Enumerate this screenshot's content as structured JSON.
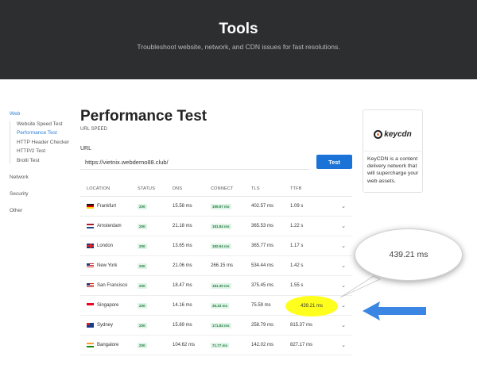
{
  "hero": {
    "title": "Tools",
    "subtitle": "Troubleshoot website, network, and CDN issues for fast resolutions."
  },
  "sidebar": {
    "web_label": "Web",
    "web_items": [
      {
        "label": "Website Speed Test",
        "active": false
      },
      {
        "label": "Performance Test",
        "active": true
      },
      {
        "label": "HTTP Header Checker",
        "active": false
      },
      {
        "label": "HTTP/2 Test",
        "active": false
      },
      {
        "label": "Brotli Test",
        "active": false
      }
    ],
    "network_label": "Network",
    "security_label": "Security",
    "other_label": "Other"
  },
  "main": {
    "title": "Performance Test",
    "subtitle": "URL SPEED",
    "url_label": "URL",
    "url_value": "https://vietnix.webdemo88.club/",
    "test_button": "Test"
  },
  "table": {
    "headers": {
      "location": "LOCATION",
      "status": "STATUS",
      "dns": "DNS",
      "connect": "CONNECT",
      "tls": "TLS",
      "ttfb": "TTFB"
    },
    "rows": [
      {
        "location": "Frankfurt",
        "flag": "de",
        "status": "200",
        "dns": "15.58 ms",
        "connect": "199.97 ms",
        "tls": "402.57 ms",
        "ttfb": "1.09 s"
      },
      {
        "location": "Amsterdam",
        "flag": "nl",
        "status": "200",
        "dns": "21.18 ms",
        "connect": "181.84 ms",
        "tls": "365.53 ms",
        "ttfb": "1.22 s"
      },
      {
        "location": "London",
        "flag": "gb",
        "status": "200",
        "dns": "13.65 ms",
        "connect": "182.94 ms",
        "tls": "365.77 ms",
        "ttfb": "1.17 s"
      },
      {
        "location": "New York",
        "flag": "us",
        "status": "200",
        "dns": "21.06 ms",
        "connect": "266.15 ms",
        "tls": "534.44 ms",
        "ttfb": "1.42 s"
      },
      {
        "location": "San Francisco",
        "flag": "us",
        "status": "200",
        "dns": "18.47 ms",
        "connect": "181.39 ms",
        "tls": "375.45 ms",
        "ttfb": "1.55 s"
      },
      {
        "location": "Singapore",
        "flag": "sg",
        "status": "200",
        "dns": "14.16 ms",
        "connect": "36.33 ms",
        "tls": "75.59 ms",
        "ttfb": "439.21 ms"
      },
      {
        "location": "Sydney",
        "flag": "au",
        "status": "200",
        "dns": "15.69 ms",
        "connect": "171.84 ms",
        "tls": "258.79 ms",
        "ttfb": "815.37 ms"
      },
      {
        "location": "Bangalore",
        "flag": "in",
        "status": "200",
        "dns": "104.62 ms",
        "connect": "71.77 ms",
        "tls": "142.02 ms",
        "ttfb": "827.17 ms"
      }
    ]
  },
  "callout": {
    "value": "439.21 ms"
  },
  "ad": {
    "logo_text": "keycdn",
    "text": "KeyCDN is a content delivery network that will supercharge your web assets."
  },
  "colors": {
    "hero_bg": "#2d2e30",
    "accent": "#1b73d8",
    "highlight": "#ffff1e",
    "arrow": "#3b86e3",
    "status_badge": "#dff3e6"
  }
}
